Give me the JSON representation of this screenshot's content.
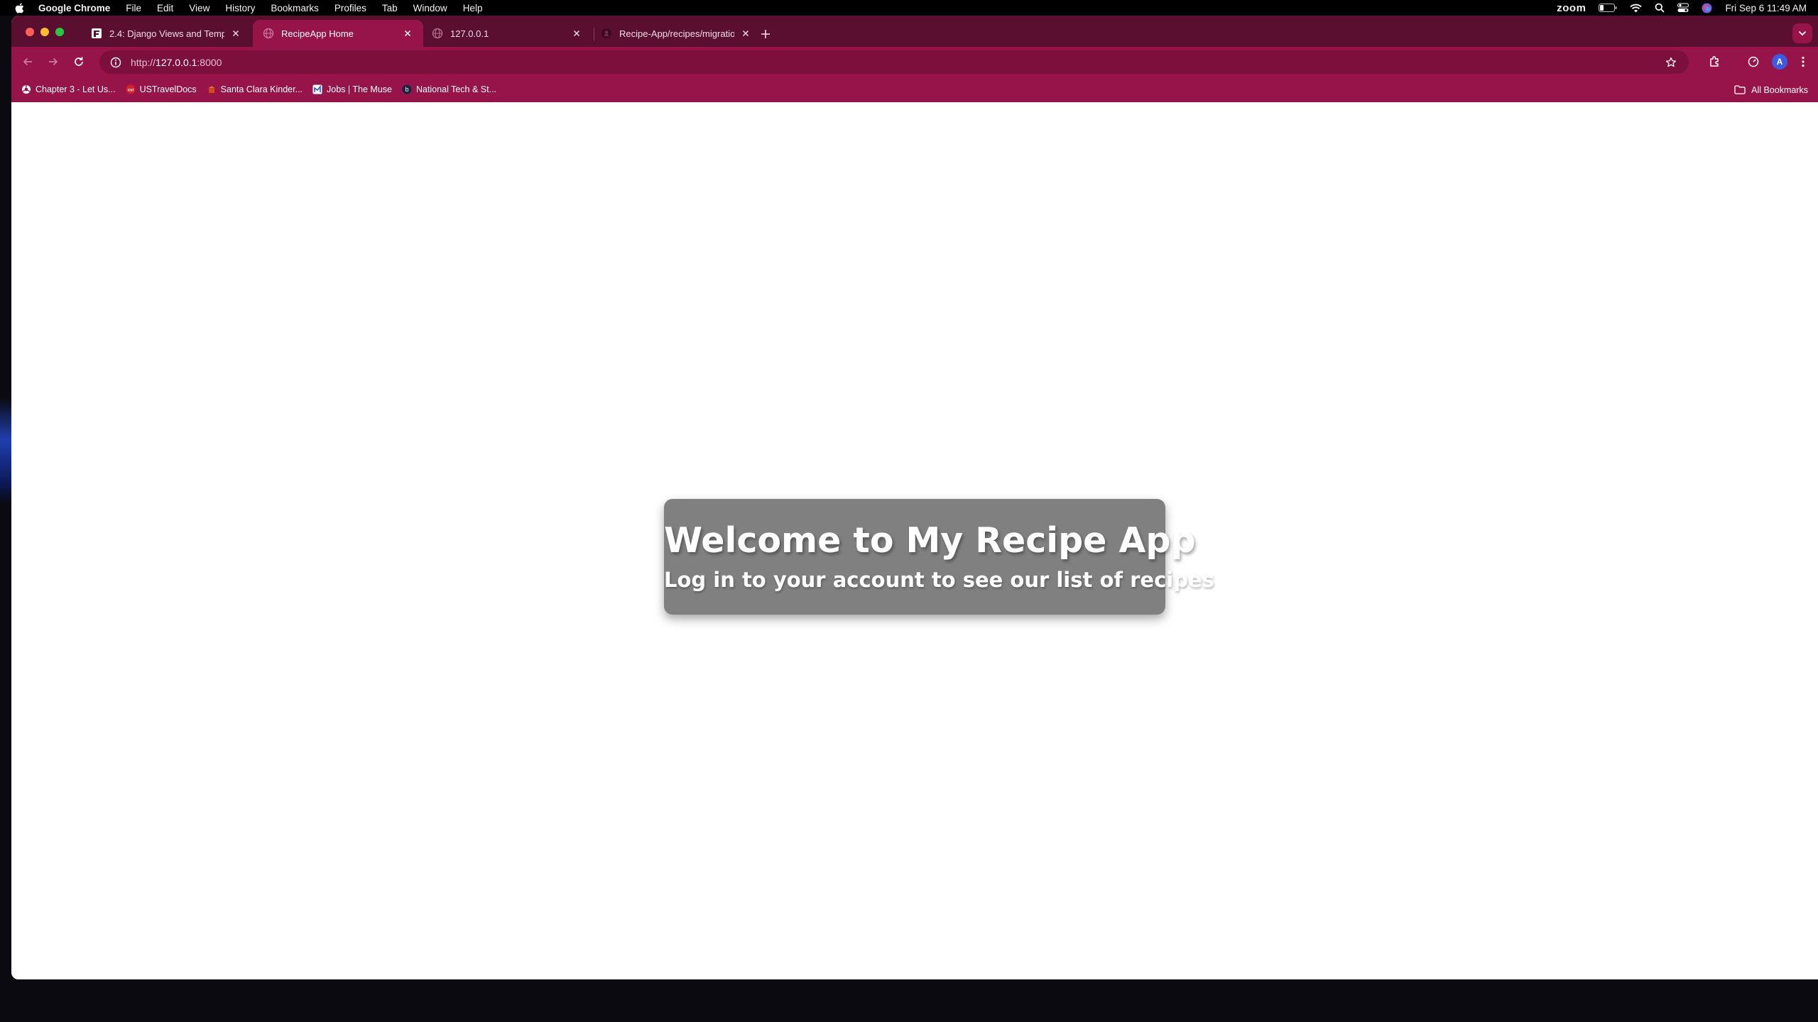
{
  "menubar": {
    "app_name": "Google Chrome",
    "items": [
      "File",
      "Edit",
      "View",
      "History",
      "Bookmarks",
      "Profiles",
      "Tab",
      "Window",
      "Help"
    ],
    "zoom_label": "zoom",
    "clock": "Fri Sep 6  11:49 AM"
  },
  "tabs": [
    {
      "title": "2.4: Django Views and Templ",
      "icon": "document-icon",
      "active": false
    },
    {
      "title": "RecipeApp Home",
      "icon": "globe-icon",
      "active": true
    },
    {
      "title": "127.0.0.1",
      "icon": "globe-icon",
      "active": false
    },
    {
      "title": "Recipe-App/recipes/migratio",
      "icon": "github-icon",
      "active": false
    }
  ],
  "omnibox": {
    "scheme": "http://",
    "host": "127.0.0.1",
    "port": ":8000"
  },
  "bookmarks": [
    {
      "label": "Chapter 3 - Let Us...",
      "icon": "chrome-page-icon"
    },
    {
      "label": "USTravelDocs",
      "icon": "ustraveldocs-icon"
    },
    {
      "label": "Santa Clara Kinder...",
      "icon": "school-icon"
    },
    {
      "label": "Jobs | The Muse",
      "icon": "muse-icon"
    },
    {
      "label": "National Tech & St...",
      "icon": "b-icon"
    }
  ],
  "all_bookmarks_label": "All Bookmarks",
  "profile_initial": "A",
  "page": {
    "title": "Welcome to My Recipe App",
    "subtitle": "Log in to your account to see our list of recipes"
  },
  "colors": {
    "tabstrip": "#5b0f30",
    "toolbar": "#97144a",
    "card": "#808080"
  }
}
